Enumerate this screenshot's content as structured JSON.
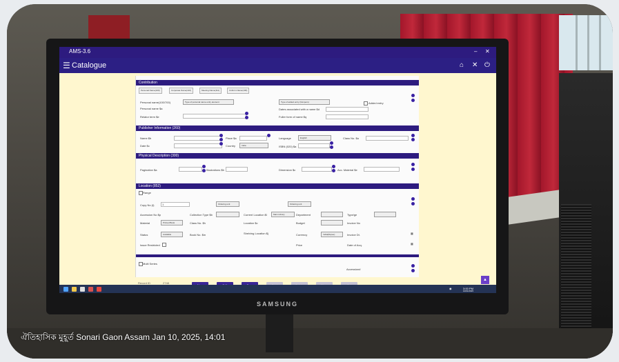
{
  "screen": {
    "window_title": "AMS-3.6",
    "app_title": "Catalogue",
    "sections": {
      "contributor": "Contribution",
      "publisher": "Publisher Information (260)",
      "physical": "Physical Description (300)",
      "location": "Location (852)",
      "multi_series": "Multi Series"
    },
    "contributor_tabs": [
      "Personal Name(100)",
      "Corporate Name(110)",
      "Meeting Name(111)",
      "Uniform Name(130)"
    ],
    "labels": {
      "personal_name": "Personal name(100/700)",
      "personal_name_2": "Personal name $a",
      "relator_term": "Relator term $e",
      "type_personal": "Type of personal name entry element",
      "type_added": "Type of added entry (Nonpers)",
      "added_entry": "Added entry",
      "fullname": "Fuller form of name $q",
      "dates": "Dates associated with a name $d",
      "name": "Name $b",
      "place": "Place $a",
      "date": "Date $c",
      "language": "Language",
      "country": "Country",
      "class_no": "Class No. $a",
      "isbn": "ISBN (020) $a",
      "pagination": "Pagination $a",
      "illustration": "Illustrations $b",
      "dimension": "Dimension $c",
      "acc_material": "Acc. Material $e",
      "range": "Range",
      "copy_no": "Copy No (t)",
      "accession": "Accession No $p",
      "collection": "Collection Type $b",
      "current_location": "Current Location $l",
      "department": "Department",
      "type_label": "Type/ge",
      "material": "Material",
      "class_no_2": "Class No. $h",
      "location_b": "Location $c",
      "budget": "Budget",
      "invoice_no": "Invoice No",
      "status": "Status",
      "book_no": "Book No. $m",
      "shelving": "Shelving Location $j",
      "currency": "Currency",
      "invoice_dt": "Invoice Dt.",
      "issue_restricted": "Issue Restricted",
      "price": "Price",
      "date_of_acq": "Date of Acq.",
      "accession_no_field": "Accession#",
      "record_id": "Record ID",
      "last_acc": "Last Acc. No."
    },
    "values": {
      "language": "English",
      "country": "India",
      "copy_no": "1",
      "material_sel": "Printed Book",
      "status_sel": "Available",
      "location_sel": "Main Library",
      "currency_sel": "India(Rupee)",
      "ordering_unit": "Ordering unit",
      "record_id_val": "2748",
      "last_acc_val": "2466"
    },
    "buttons": {
      "new": "New",
      "edit": "Edit",
      "save": "Save",
      "b4": "Print",
      "b5": "Delete",
      "b6": "Close",
      "b7": "Cat"
    },
    "tray_time": "3:00 PM",
    "tray_date": "10/01/2025"
  },
  "monitor_brand": "SAMSUNG",
  "caption": "ঐতিহাসিক মুহূর্ত  Sonari Gaon Assam  Jan 10, 2025, 14:01"
}
